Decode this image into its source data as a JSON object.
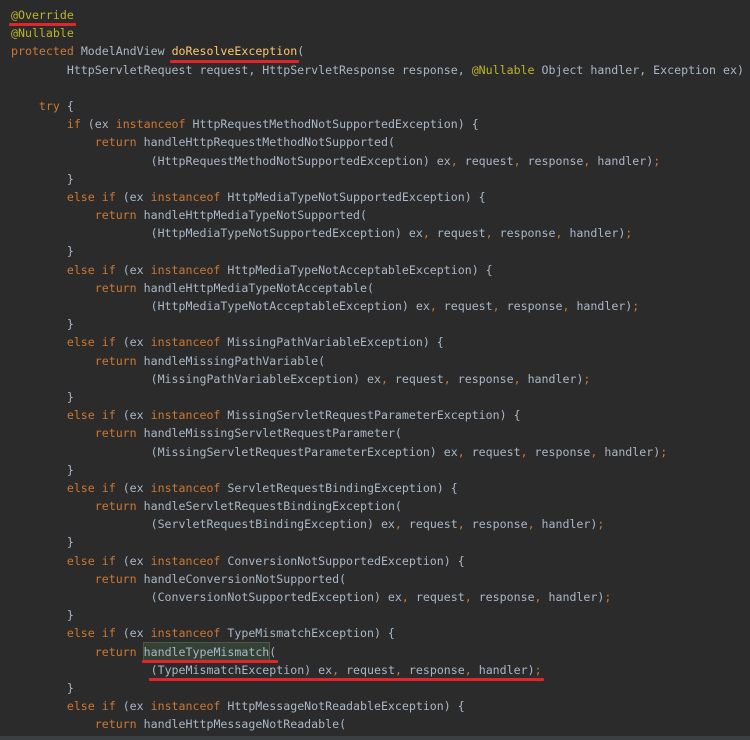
{
  "code_lines": [
    [
      {
        "t": "@Override",
        "c": "ann",
        "u": true
      }
    ],
    [
      {
        "t": "@Nullable",
        "c": "ann"
      }
    ],
    [
      {
        "t": "protected ",
        "c": "kw"
      },
      {
        "t": "ModelAndView ",
        "c": "plain"
      },
      {
        "t": "doResolveException",
        "c": "fn",
        "u": true
      },
      {
        "t": "(",
        "c": "plain"
      }
    ],
    [
      {
        "t": "        HttpServletRequest request, HttpServletResponse response, ",
        "c": "plain"
      },
      {
        "t": "@Nullable ",
        "c": "ann"
      },
      {
        "t": "Object handler, Exception ex) {",
        "c": "plain"
      }
    ],
    [],
    [
      {
        "t": "    ",
        "c": "plain"
      },
      {
        "t": "try ",
        "c": "kw"
      },
      {
        "t": "{",
        "c": "plain"
      }
    ],
    [
      {
        "t": "        ",
        "c": "plain"
      },
      {
        "t": "if ",
        "c": "kw"
      },
      {
        "t": "(ex ",
        "c": "plain"
      },
      {
        "t": "instanceof ",
        "c": "kw"
      },
      {
        "t": "HttpRequestMethodNotSupportedException) {",
        "c": "plain"
      }
    ],
    [
      {
        "t": "            ",
        "c": "plain"
      },
      {
        "t": "return ",
        "c": "kw"
      },
      {
        "t": "handleHttpRequestMethodNotSupported(",
        "c": "plain"
      }
    ],
    [
      {
        "t": "                    (HttpRequestMethodNotSupportedException) ex",
        "c": "plain"
      },
      {
        "t": ", ",
        "c": "kw"
      },
      {
        "t": "request",
        "c": "plain"
      },
      {
        "t": ", ",
        "c": "kw"
      },
      {
        "t": "response",
        "c": "plain"
      },
      {
        "t": ", ",
        "c": "kw"
      },
      {
        "t": "handler)",
        "c": "plain"
      },
      {
        "t": ";",
        "c": "kw"
      }
    ],
    [
      {
        "t": "        }",
        "c": "plain"
      }
    ],
    [
      {
        "t": "        ",
        "c": "plain"
      },
      {
        "t": "else if ",
        "c": "kw"
      },
      {
        "t": "(ex ",
        "c": "plain"
      },
      {
        "t": "instanceof ",
        "c": "kw"
      },
      {
        "t": "HttpMediaTypeNotSupportedException) {",
        "c": "plain"
      }
    ],
    [
      {
        "t": "            ",
        "c": "plain"
      },
      {
        "t": "return ",
        "c": "kw"
      },
      {
        "t": "handleHttpMediaTypeNotSupported(",
        "c": "plain"
      }
    ],
    [
      {
        "t": "                    (HttpMediaTypeNotSupportedException) ex",
        "c": "plain"
      },
      {
        "t": ", ",
        "c": "kw"
      },
      {
        "t": "request",
        "c": "plain"
      },
      {
        "t": ", ",
        "c": "kw"
      },
      {
        "t": "response",
        "c": "plain"
      },
      {
        "t": ", ",
        "c": "kw"
      },
      {
        "t": "handler)",
        "c": "plain"
      },
      {
        "t": ";",
        "c": "kw"
      }
    ],
    [
      {
        "t": "        }",
        "c": "plain"
      }
    ],
    [
      {
        "t": "        ",
        "c": "plain"
      },
      {
        "t": "else if ",
        "c": "kw"
      },
      {
        "t": "(ex ",
        "c": "plain"
      },
      {
        "t": "instanceof ",
        "c": "kw"
      },
      {
        "t": "HttpMediaTypeNotAcceptableException) {",
        "c": "plain"
      }
    ],
    [
      {
        "t": "            ",
        "c": "plain"
      },
      {
        "t": "return ",
        "c": "kw"
      },
      {
        "t": "handleHttpMediaTypeNotAcceptable(",
        "c": "plain"
      }
    ],
    [
      {
        "t": "                    (HttpMediaTypeNotAcceptableException) ex",
        "c": "plain"
      },
      {
        "t": ", ",
        "c": "kw"
      },
      {
        "t": "request",
        "c": "plain"
      },
      {
        "t": ", ",
        "c": "kw"
      },
      {
        "t": "response",
        "c": "plain"
      },
      {
        "t": ", ",
        "c": "kw"
      },
      {
        "t": "handler)",
        "c": "plain"
      },
      {
        "t": ";",
        "c": "kw"
      }
    ],
    [
      {
        "t": "        }",
        "c": "plain"
      }
    ],
    [
      {
        "t": "        ",
        "c": "plain"
      },
      {
        "t": "else if ",
        "c": "kw"
      },
      {
        "t": "(ex ",
        "c": "plain"
      },
      {
        "t": "instanceof ",
        "c": "kw"
      },
      {
        "t": "MissingPathVariableException) {",
        "c": "plain"
      }
    ],
    [
      {
        "t": "            ",
        "c": "plain"
      },
      {
        "t": "return ",
        "c": "kw"
      },
      {
        "t": "handleMissingPathVariable(",
        "c": "plain"
      }
    ],
    [
      {
        "t": "                    (MissingPathVariableException) ex",
        "c": "plain"
      },
      {
        "t": ", ",
        "c": "kw"
      },
      {
        "t": "request",
        "c": "plain"
      },
      {
        "t": ", ",
        "c": "kw"
      },
      {
        "t": "response",
        "c": "plain"
      },
      {
        "t": ", ",
        "c": "kw"
      },
      {
        "t": "handler)",
        "c": "plain"
      },
      {
        "t": ";",
        "c": "kw"
      }
    ],
    [
      {
        "t": "        }",
        "c": "plain"
      }
    ],
    [
      {
        "t": "        ",
        "c": "plain"
      },
      {
        "t": "else if ",
        "c": "kw"
      },
      {
        "t": "(ex ",
        "c": "plain"
      },
      {
        "t": "instanceof ",
        "c": "kw"
      },
      {
        "t": "MissingServletRequestParameterException) {",
        "c": "plain"
      }
    ],
    [
      {
        "t": "            ",
        "c": "plain"
      },
      {
        "t": "return ",
        "c": "kw"
      },
      {
        "t": "handleMissingServletRequestParameter(",
        "c": "plain"
      }
    ],
    [
      {
        "t": "                    (MissingServletRequestParameterException) ex",
        "c": "plain"
      },
      {
        "t": ", ",
        "c": "kw"
      },
      {
        "t": "request",
        "c": "plain"
      },
      {
        "t": ", ",
        "c": "kw"
      },
      {
        "t": "response",
        "c": "plain"
      },
      {
        "t": ", ",
        "c": "kw"
      },
      {
        "t": "handler)",
        "c": "plain"
      },
      {
        "t": ";",
        "c": "kw"
      }
    ],
    [
      {
        "t": "        }",
        "c": "plain"
      }
    ],
    [
      {
        "t": "        ",
        "c": "plain"
      },
      {
        "t": "else if ",
        "c": "kw"
      },
      {
        "t": "(ex ",
        "c": "plain"
      },
      {
        "t": "instanceof ",
        "c": "kw"
      },
      {
        "t": "ServletRequestBindingException) {",
        "c": "plain"
      }
    ],
    [
      {
        "t": "            ",
        "c": "plain"
      },
      {
        "t": "return ",
        "c": "kw"
      },
      {
        "t": "handleServletRequestBindingException(",
        "c": "plain"
      }
    ],
    [
      {
        "t": "                    (ServletRequestBindingException) ex",
        "c": "plain"
      },
      {
        "t": ", ",
        "c": "kw"
      },
      {
        "t": "request",
        "c": "plain"
      },
      {
        "t": ", ",
        "c": "kw"
      },
      {
        "t": "response",
        "c": "plain"
      },
      {
        "t": ", ",
        "c": "kw"
      },
      {
        "t": "handler)",
        "c": "plain"
      },
      {
        "t": ";",
        "c": "kw"
      }
    ],
    [
      {
        "t": "        }",
        "c": "plain"
      }
    ],
    [
      {
        "t": "        ",
        "c": "plain"
      },
      {
        "t": "else if ",
        "c": "kw"
      },
      {
        "t": "(ex ",
        "c": "plain"
      },
      {
        "t": "instanceof ",
        "c": "kw"
      },
      {
        "t": "ConversionNotSupportedException) {",
        "c": "plain"
      }
    ],
    [
      {
        "t": "            ",
        "c": "plain"
      },
      {
        "t": "return ",
        "c": "kw"
      },
      {
        "t": "handleConversionNotSupported(",
        "c": "plain"
      }
    ],
    [
      {
        "t": "                    (ConversionNotSupportedException) ex",
        "c": "plain"
      },
      {
        "t": ", ",
        "c": "kw"
      },
      {
        "t": "request",
        "c": "plain"
      },
      {
        "t": ", ",
        "c": "kw"
      },
      {
        "t": "response",
        "c": "plain"
      },
      {
        "t": ", ",
        "c": "kw"
      },
      {
        "t": "handler)",
        "c": "plain"
      },
      {
        "t": ";",
        "c": "kw"
      }
    ],
    [
      {
        "t": "        }",
        "c": "plain"
      }
    ],
    [
      {
        "t": "        ",
        "c": "plain"
      },
      {
        "t": "else if ",
        "c": "kw"
      },
      {
        "t": "(ex ",
        "c": "plain"
      },
      {
        "t": "instanceof ",
        "c": "kw"
      },
      {
        "t": "TypeMismatchException) {",
        "c": "plain"
      }
    ],
    [
      {
        "t": "            ",
        "c": "plain"
      },
      {
        "t": "return ",
        "c": "kw"
      },
      {
        "t": "handleTypeMismatch",
        "c": "plain",
        "u": true,
        "h": true
      },
      {
        "t": "(",
        "c": "plain",
        "u": true
      }
    ],
    [
      {
        "t": "                    ",
        "c": "plain"
      },
      {
        "t": "(TypeMismatchException) ex",
        "c": "plain",
        "u": true
      },
      {
        "t": ", ",
        "c": "kw",
        "u": true
      },
      {
        "t": "request",
        "c": "plain",
        "u": true
      },
      {
        "t": ", ",
        "c": "kw",
        "u": true
      },
      {
        "t": "response",
        "c": "plain",
        "u": true
      },
      {
        "t": ", ",
        "c": "kw",
        "u": true
      },
      {
        "t": "handler)",
        "c": "plain",
        "u": true
      },
      {
        "t": ";",
        "c": "kw",
        "u": true
      }
    ],
    [
      {
        "t": "        }",
        "c": "plain"
      }
    ],
    [
      {
        "t": "        ",
        "c": "plain"
      },
      {
        "t": "else if ",
        "c": "kw"
      },
      {
        "t": "(ex ",
        "c": "plain"
      },
      {
        "t": "instanceof ",
        "c": "kw"
      },
      {
        "t": "HttpMessageNotReadableException) {",
        "c": "plain"
      }
    ],
    [
      {
        "t": "            ",
        "c": "plain"
      },
      {
        "t": "return ",
        "c": "kw"
      },
      {
        "t": "handleHttpMessageNotReadable(",
        "c": "plain"
      }
    ]
  ],
  "colors": {
    "background": "#2b2b2b",
    "keyword": "#cc7832",
    "annotation": "#bbb529",
    "method_declaration": "#ffc66d",
    "plain": "#a9b7c6",
    "markup_underline": "#e0262a"
  }
}
